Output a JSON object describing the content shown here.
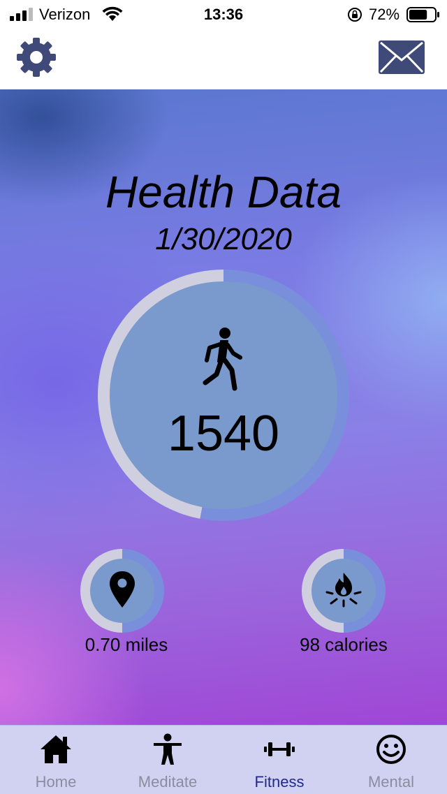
{
  "status_bar": {
    "carrier": "Verizon",
    "time": "13:36",
    "battery_percent": "72%",
    "battery_level": 0.72,
    "icons": [
      "signal-icon",
      "wifi-icon",
      "orientation-lock-icon",
      "battery-icon"
    ]
  },
  "header": {
    "left_icon": "gear-icon",
    "right_icon": "mail-icon",
    "icon_color": "#3f4a78"
  },
  "main": {
    "title": "Health Data",
    "date": "1/30/2020",
    "steps": {
      "value": "1540",
      "icon": "walk-icon",
      "progress": 0.53
    },
    "distance": {
      "label": "0.70 miles",
      "icon": "location-pin-icon",
      "progress": 0.5
    },
    "calories": {
      "label": "98 calories",
      "icon": "campfire-icon",
      "progress": 0.5
    },
    "colors": {
      "ring_progress": "#7a8fdc",
      "ring_track": "#cfcfdf",
      "circle_fill": "#7a9acd"
    }
  },
  "tabs": [
    {
      "label": "Home",
      "icon": "home-icon",
      "active": false
    },
    {
      "label": "Meditate",
      "icon": "person-icon",
      "active": false
    },
    {
      "label": "Fitness",
      "icon": "dumbbell-icon",
      "active": true
    },
    {
      "label": "Mental",
      "icon": "smiley-icon",
      "active": false
    }
  ]
}
